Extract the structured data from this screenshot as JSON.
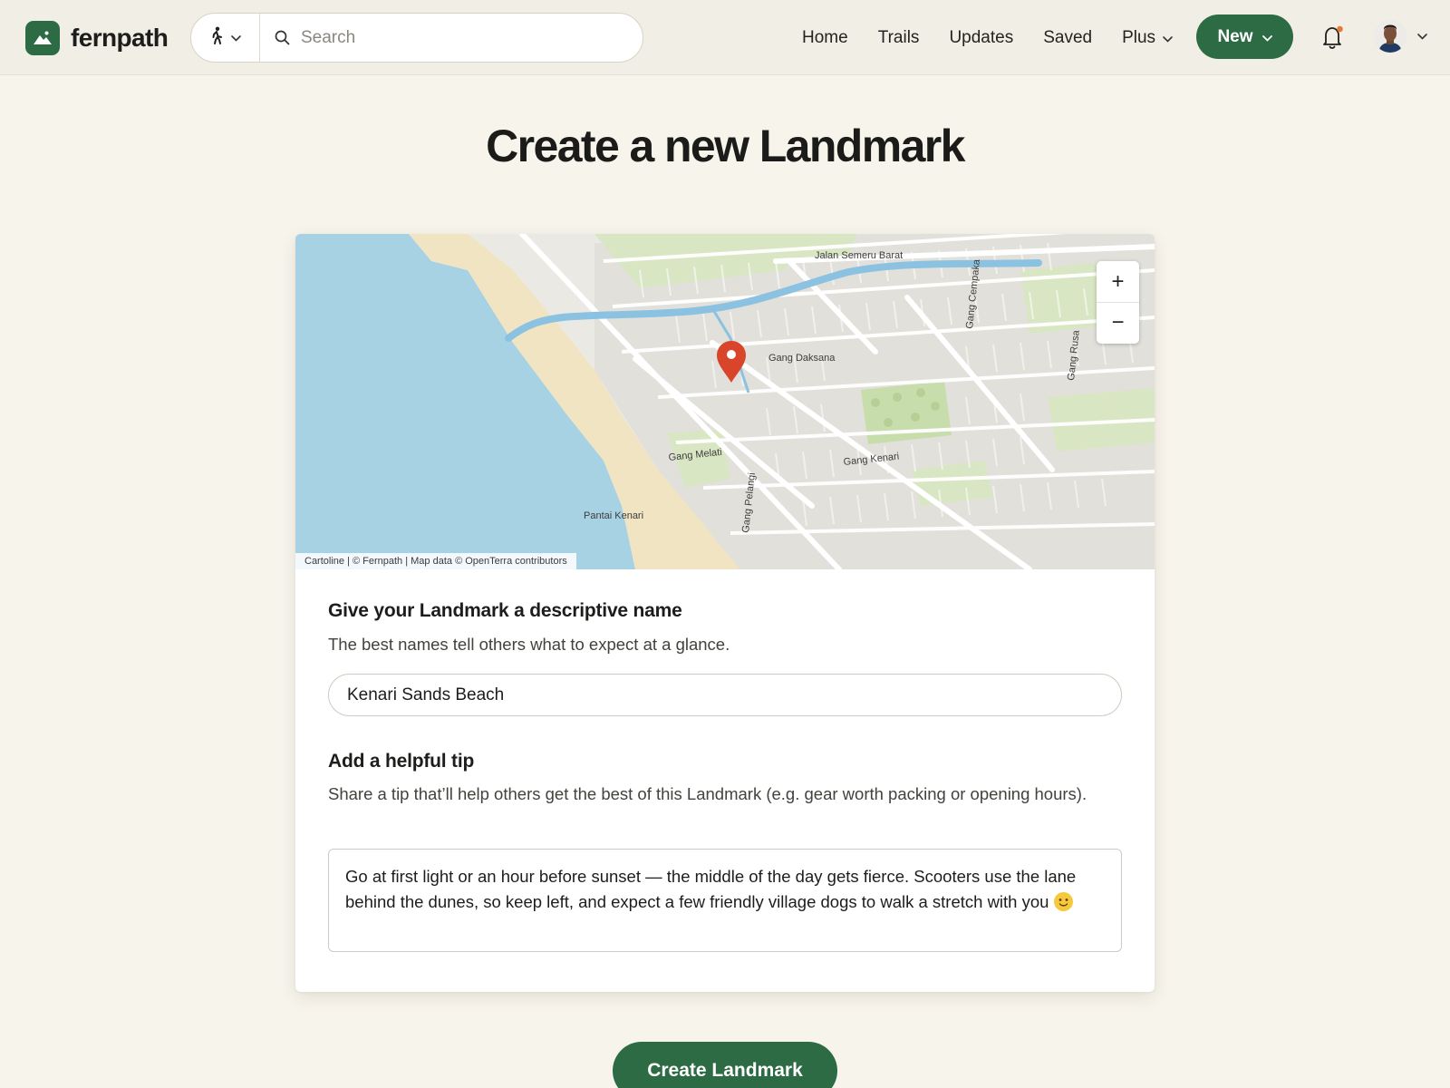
{
  "header": {
    "logo_text": "fernpath",
    "search_placeholder": "Search",
    "nav": [
      {
        "label": "Home"
      },
      {
        "label": "Trails"
      },
      {
        "label": "Updates"
      },
      {
        "label": "Saved"
      },
      {
        "label": "Plus"
      }
    ],
    "new_button": "New",
    "icons": {
      "logo": "mountain-icon",
      "mode": "walking-person-icon",
      "search": "search-icon",
      "notifications": "bell-icon",
      "avatar": "user-avatar"
    },
    "notification_dot_color": "#e8773a"
  },
  "page": {
    "title": "Create a new Landmark"
  },
  "map": {
    "labels": {
      "jalan_semeru_barat": "Jalan Semeru Barat",
      "gang_cempaka": "Gang Cempaka",
      "gang_rusa": "Gang Rusa",
      "gang_daksana": "Gang Daksana",
      "gang_melati": "Gang Melati",
      "gang_kenari": "Gang Kenari",
      "gang_pelangi": "Gang Pelangi",
      "pantai_kenari": "Pantai Kenari"
    },
    "attribution": "Cartoline | © Fernpath | Map data © OpenTerra contributors",
    "zoom_in": "+",
    "zoom_out": "−",
    "marker_color": "#d9452b",
    "water_color": "#a6d2e4",
    "sand_color": "#f1e4c2"
  },
  "form": {
    "name_title": "Give your Landmark a descriptive name",
    "name_help": "The best names tell others what to expect at a glance.",
    "name_value": "Kenari Sands Beach",
    "tip_title": "Add a helpful tip",
    "tip_help": "Share a tip that’ll help others get the best of this Landmark (e.g. gear worth packing or opening hours).",
    "tip_value": "Go at first light or an hour before sunset — the middle of the day gets fierce. Scooters use the lane behind the dunes, so keep left, and expect a few friendly village dogs to walk a stretch with you",
    "tip_emoji": "slightly-smiling-face-emoji",
    "submit_label": "Create Landmark"
  },
  "colors": {
    "brand_green": "#2d6b44",
    "background": "#f7f4ec"
  }
}
